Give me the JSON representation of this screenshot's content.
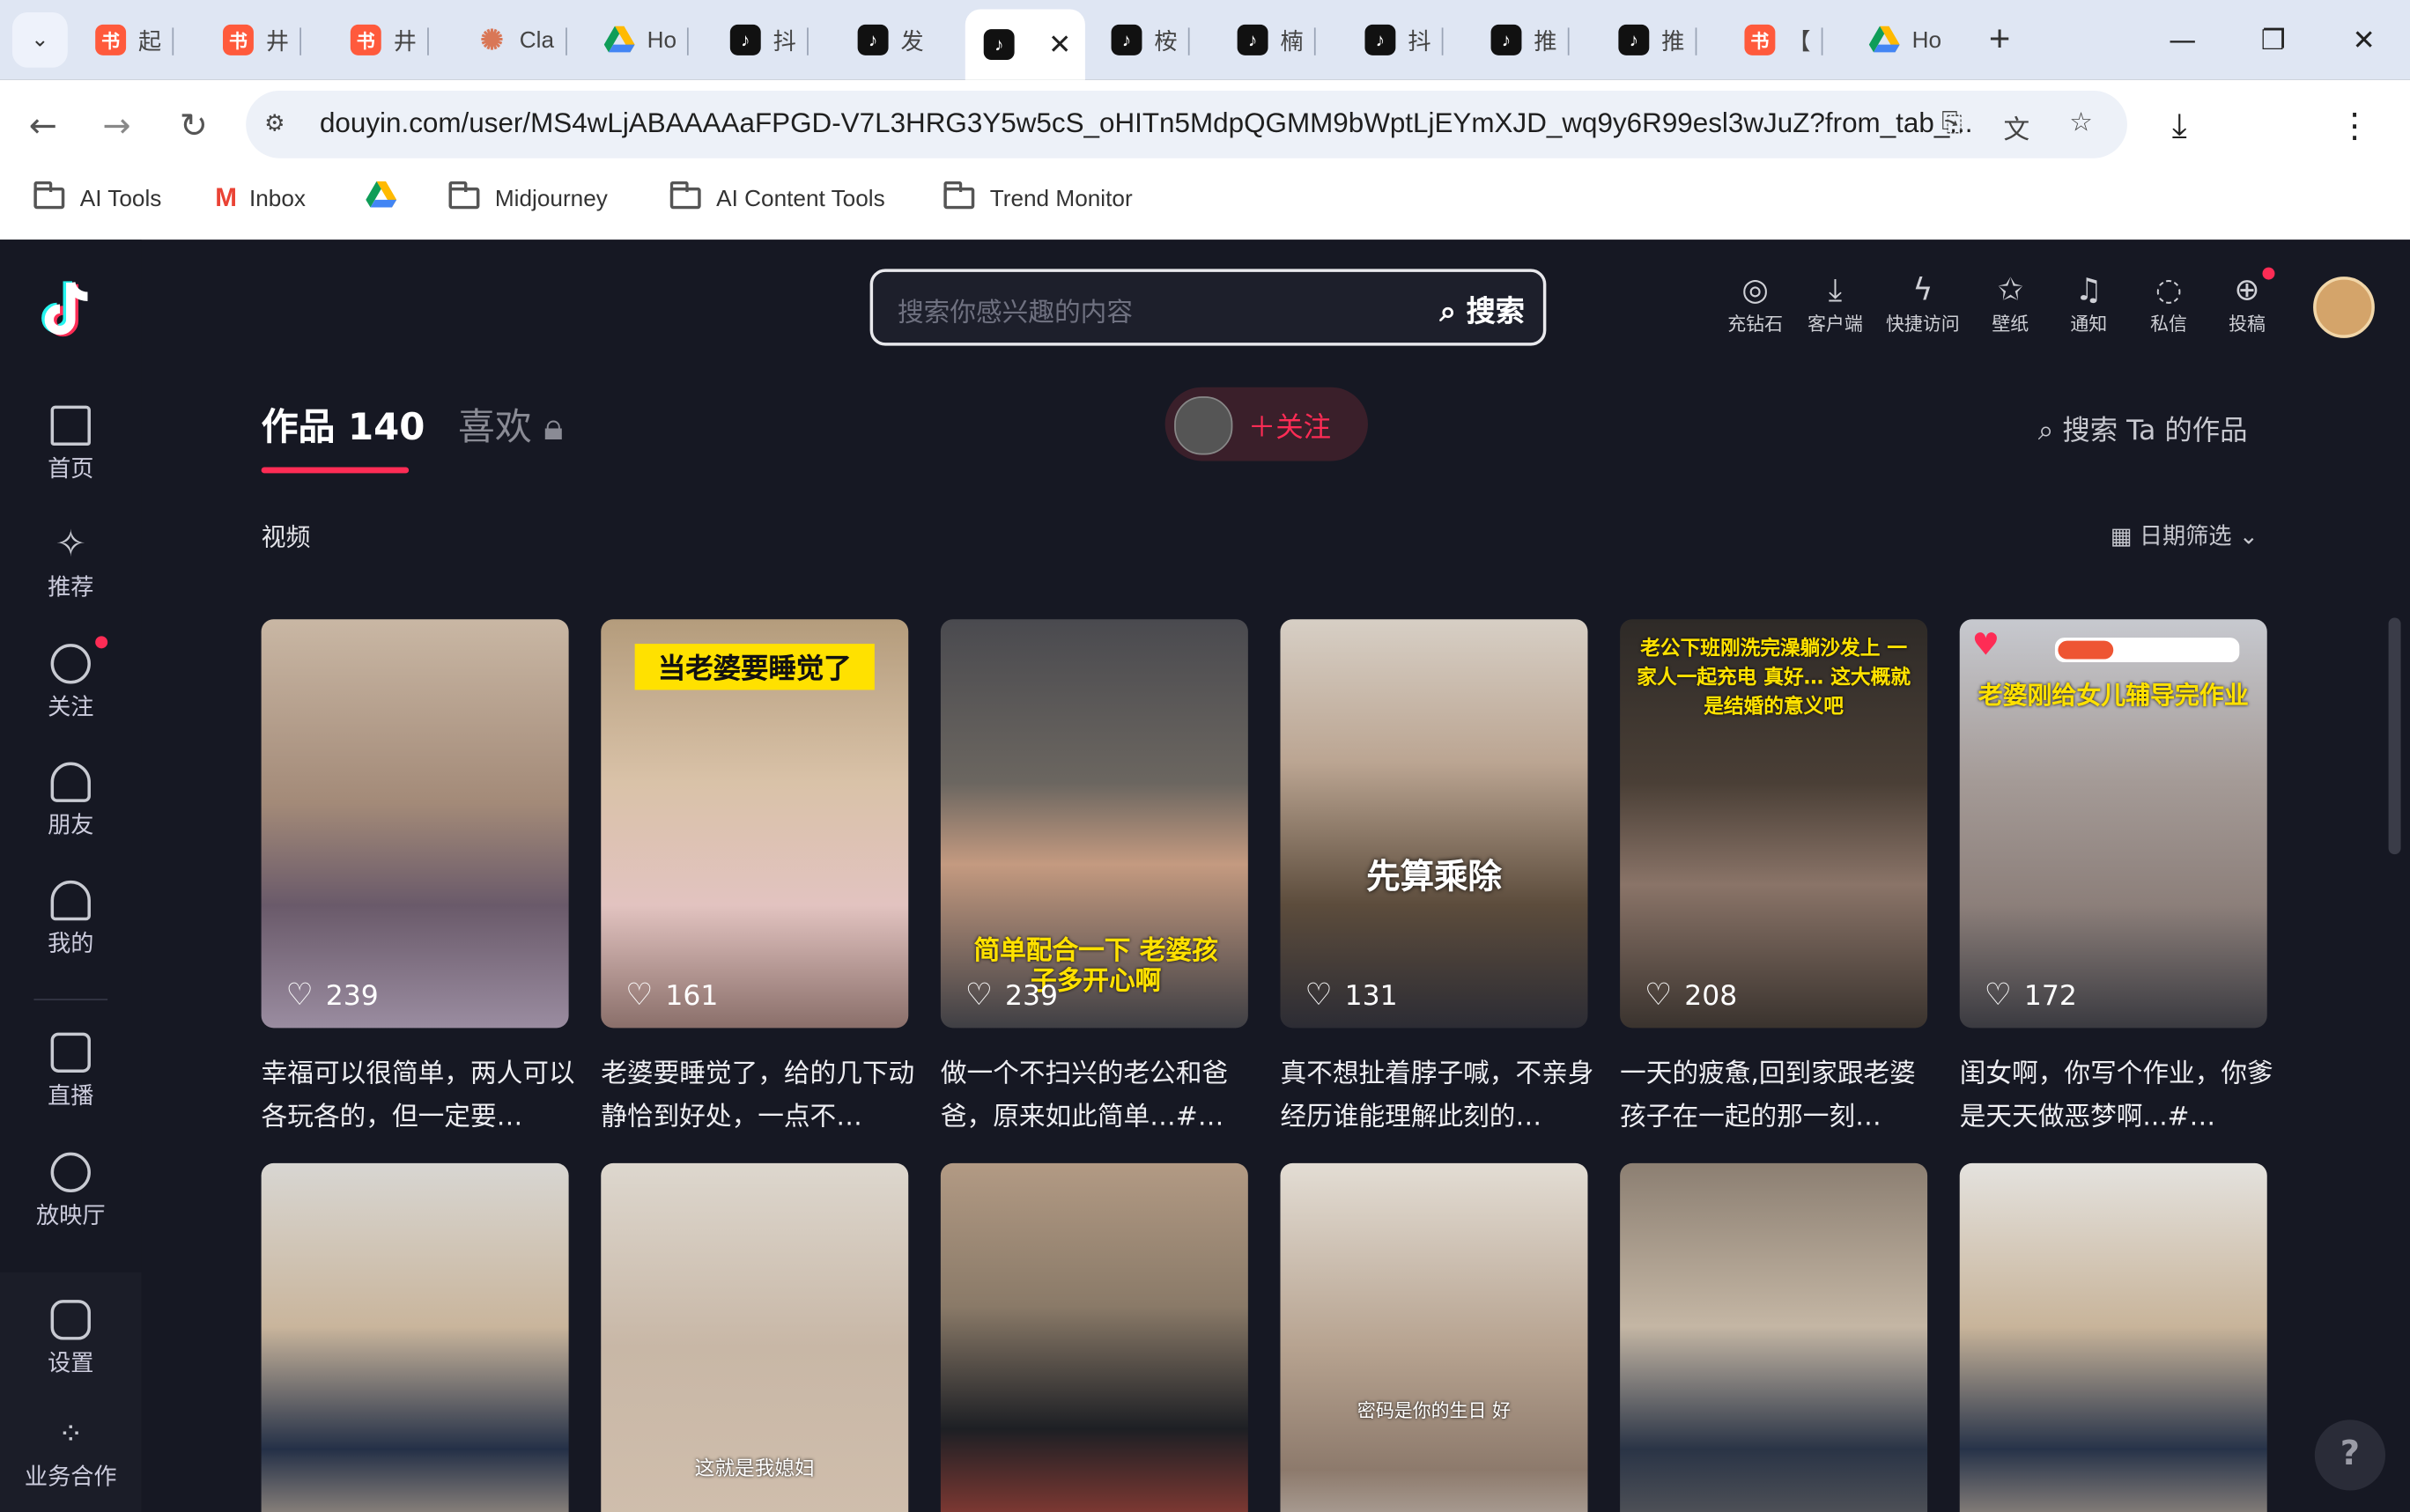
{
  "browser": {
    "tabs": [
      {
        "label": "起",
        "icon": "xiaohongshu-icon"
      },
      {
        "label": "井",
        "icon": "xiaohongshu-icon"
      },
      {
        "label": "井",
        "icon": "xiaohongshu-icon"
      },
      {
        "label": "Cla",
        "icon": "claude-icon"
      },
      {
        "label": "Ho",
        "icon": "google-drive-icon"
      },
      {
        "label": "抖",
        "icon": "douyin-icon"
      },
      {
        "label": "发",
        "icon": "douyin-icon"
      },
      {
        "label": "",
        "icon": "douyin-icon",
        "active": true
      },
      {
        "label": "桉",
        "icon": "douyin-icon"
      },
      {
        "label": "楠",
        "icon": "douyin-icon"
      },
      {
        "label": "抖",
        "icon": "douyin-icon"
      },
      {
        "label": "推",
        "icon": "douyin-icon"
      },
      {
        "label": "推",
        "icon": "douyin-icon"
      },
      {
        "label": "【",
        "icon": "xiaohongshu-icon"
      },
      {
        "label": "Ho",
        "icon": "google-drive-icon"
      }
    ],
    "url": "douyin.com/user/MS4wLjABAAAAaFPGD-V7L3HRG3Y5w5cS_oHITn5MdpQGMM9bWptLjEYmXJD_wq9y6R99esl3wJuZ?from_tab_...",
    "bookmarks": [
      "AI Tools",
      "Inbox",
      "",
      "Midjourney",
      "AI Content Tools",
      "Trend Monitor"
    ]
  },
  "douyin": {
    "search_placeholder": "搜索你感兴趣的内容",
    "search_button": "搜索",
    "top_icons": [
      "充钻石",
      "客户端",
      "快捷访问",
      "壁纸",
      "通知",
      "私信",
      "投稿"
    ],
    "nav": [
      "首页",
      "推荐",
      "关注",
      "朋友",
      "我的",
      "直播",
      "放映厅",
      "设置",
      "业务合作"
    ],
    "tab_works": "作品 140",
    "tab_likes": "喜欢",
    "follow": "关注",
    "search_works": "搜索 Ta 的作品",
    "section": "视频",
    "date_filter": "日期筛选",
    "videos": [
      {
        "likes": "239",
        "caption": "幸福可以很简单，两人可以各玩各的，但一定要…",
        "overlay": ""
      },
      {
        "likes": "161",
        "caption": "老婆要睡觉了，给的几下动静恰到好处，一点不…",
        "overlay": "当老婆要睡觉了"
      },
      {
        "likes": "239",
        "caption": "做一个不扫兴的老公和爸爸，原来如此简单…#…",
        "overlay": "简单配合一下 老婆孩子多开心啊"
      },
      {
        "likes": "131",
        "caption": "真不想扯着脖子喊，不亲身经历谁能理解此刻的…",
        "overlay": "先算乘除"
      },
      {
        "likes": "208",
        "caption": "一天的疲惫,回到家跟老婆孩子在一起的那一刻…",
        "overlay": "老公下班刚洗完澡躺沙发上 一家人一起充电 真好… 这大概就是结婚的意义吧"
      },
      {
        "likes": "172",
        "caption": "闺女啊，你写个作业，你爹是天天做恶梦啊...#…",
        "overlay": "老婆刚给女儿辅导完作业"
      },
      {
        "overlay": ""
      },
      {
        "overlay": "这就是我媳妇"
      },
      {
        "overlay": ""
      },
      {
        "overlay": "密码是你的生日 好"
      },
      {
        "overlay": ""
      },
      {
        "overlay": ""
      }
    ]
  }
}
